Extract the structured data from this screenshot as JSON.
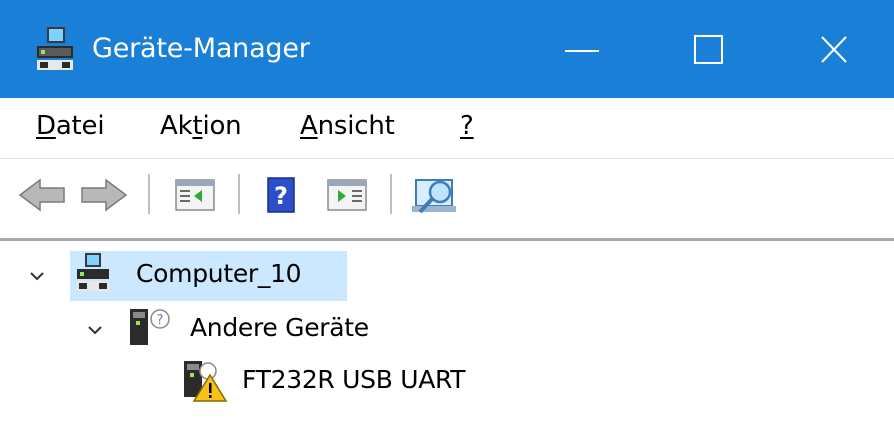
{
  "window": {
    "title": "Geräte-Manager",
    "accent": "#1a7fd6",
    "controls": {
      "minimize": "minimize-icon",
      "maximize": "maximize-icon",
      "close": "close-icon"
    }
  },
  "menu": {
    "datei": {
      "pre": "",
      "accel": "D",
      "post": "atei"
    },
    "aktion": {
      "pre": "Ak",
      "accel": "t",
      "post": "ion"
    },
    "ansicht": {
      "pre": "",
      "accel": "A",
      "post": "nsicht"
    },
    "help": {
      "pre": "",
      "accel": "?",
      "post": ""
    }
  },
  "toolbar": {
    "buttons": [
      "back-arrow-icon",
      "forward-arrow-icon",
      "show-hide-console-tree-icon",
      "help-icon",
      "properties-icon",
      "scan-hardware-icon"
    ]
  },
  "tree": {
    "root": {
      "label": "Computer_10",
      "expanded": true,
      "selected": true
    },
    "category": {
      "label": "Andere Geräte",
      "expanded": true
    },
    "device": {
      "label": "FT232R USB UART",
      "status": "warning"
    }
  },
  "colors": {
    "selection": "#cce8ff",
    "warning": "#f4c21b"
  }
}
